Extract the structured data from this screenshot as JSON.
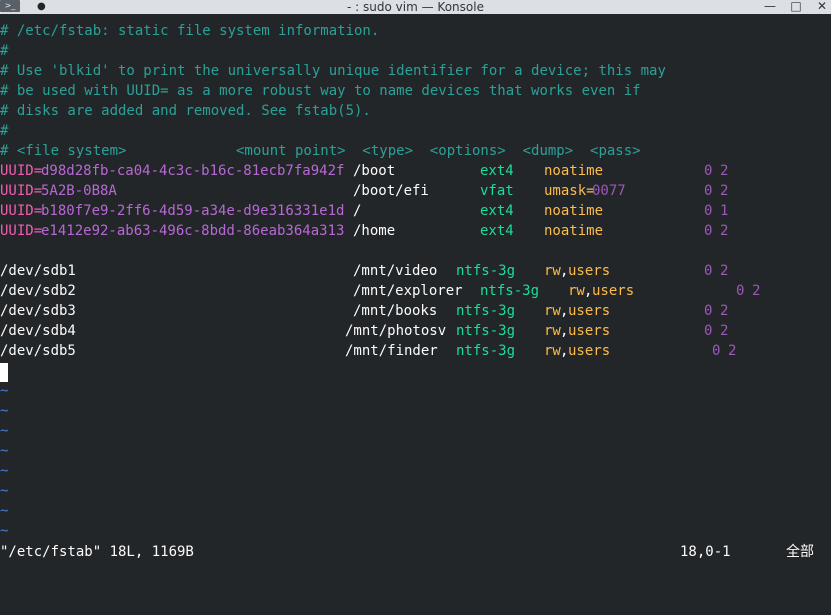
{
  "window": {
    "title": "- : sudo vim — Konsole",
    "app_icon": ">_",
    "pin_glyph": "●",
    "minimize": "—",
    "maximize": "□",
    "close": "✕"
  },
  "editor": {
    "comments": [
      "# /etc/fstab: static file system information.",
      "#",
      "# Use 'blkid' to print the universally unique identifier for a device; this may",
      "# be used with UUID= as a more robust way to name devices that works even if",
      "# disks are added and removed. See fstab(5).",
      "#",
      "# <file system>             <mount point>  <type>  <options>  <dump>  <pass>"
    ],
    "uuid_entries": [
      {
        "key": "UUID=",
        "value": "d98d28fb-ca04-4c3c-b16c-81ecb7fa942f",
        "mount": "/boot",
        "type": "ext4",
        "opt1": "noatime",
        "opt_sep": "",
        "opt2": "",
        "dump": "0",
        "pass": "2"
      },
      {
        "key": "UUID=",
        "value": "5A2B-0B8A",
        "mount": "/boot/efi",
        "type": "vfat",
        "opt1": "umask=",
        "opt_sep": "",
        "opt2": "0077",
        "dump": "0",
        "pass": "2"
      },
      {
        "key": "UUID=",
        "value": "b180f7e9-2ff6-4d59-a34e-d9e316331e1d",
        "mount": "/",
        "type": "ext4",
        "opt1": "noatime",
        "opt_sep": "",
        "opt2": "",
        "dump": "0",
        "pass": "1"
      },
      {
        "key": "UUID=",
        "value": "e1412e92-ab63-496c-8bdd-86eab364a313",
        "mount": "/home",
        "type": "ext4",
        "opt1": "noatime",
        "opt_sep": "",
        "opt2": "",
        "dump": "0",
        "pass": "2"
      }
    ],
    "dev_entries": [
      {
        "dev": "/dev/sdb1",
        "mount": "/mnt/video",
        "type": "ntfs-3g",
        "opt1": "rw",
        "opt_sep": ",",
        "opt2": "users",
        "dump": "0",
        "pass": "2"
      },
      {
        "dev": "/dev/sdb2",
        "mount": "/mnt/explorer",
        "type": "ntfs-3g",
        "opt1": "rw",
        "opt_sep": ",",
        "opt2": "users",
        "dump": "0",
        "pass": "2"
      },
      {
        "dev": "/dev/sdb3",
        "mount": "/mnt/books",
        "type": "ntfs-3g",
        "opt1": "rw",
        "opt_sep": ",",
        "opt2": "users",
        "dump": "0",
        "pass": "2"
      },
      {
        "dev": "/dev/sdb4",
        "mount": "/mnt/photosv",
        "type": "ntfs-3g",
        "opt1": "rw",
        "opt_sep": ",",
        "opt2": "users",
        "dump": "0",
        "pass": "2"
      },
      {
        "dev": "/dev/sdb5",
        "mount": "/mnt/finder",
        "type": "ntfs-3g",
        "opt1": "rw",
        "opt_sep": ",",
        "opt2": "users",
        "dump": "0",
        "pass": "2"
      }
    ],
    "tilde": "~",
    "tilde_count": 8
  },
  "status": {
    "file_info": "\"/etc/fstab\" 18L, 1169B",
    "position": "18,0-1",
    "scroll": "全部"
  },
  "colors": {
    "background": "#232629",
    "comment": "#2aa198",
    "uuid_key": "#f45bb0",
    "uuid_value": "#b868d4",
    "type": "#1cdc9a",
    "options": "#fdbc4b",
    "number": "#9b59b6",
    "tilde": "#3a7fd6"
  }
}
